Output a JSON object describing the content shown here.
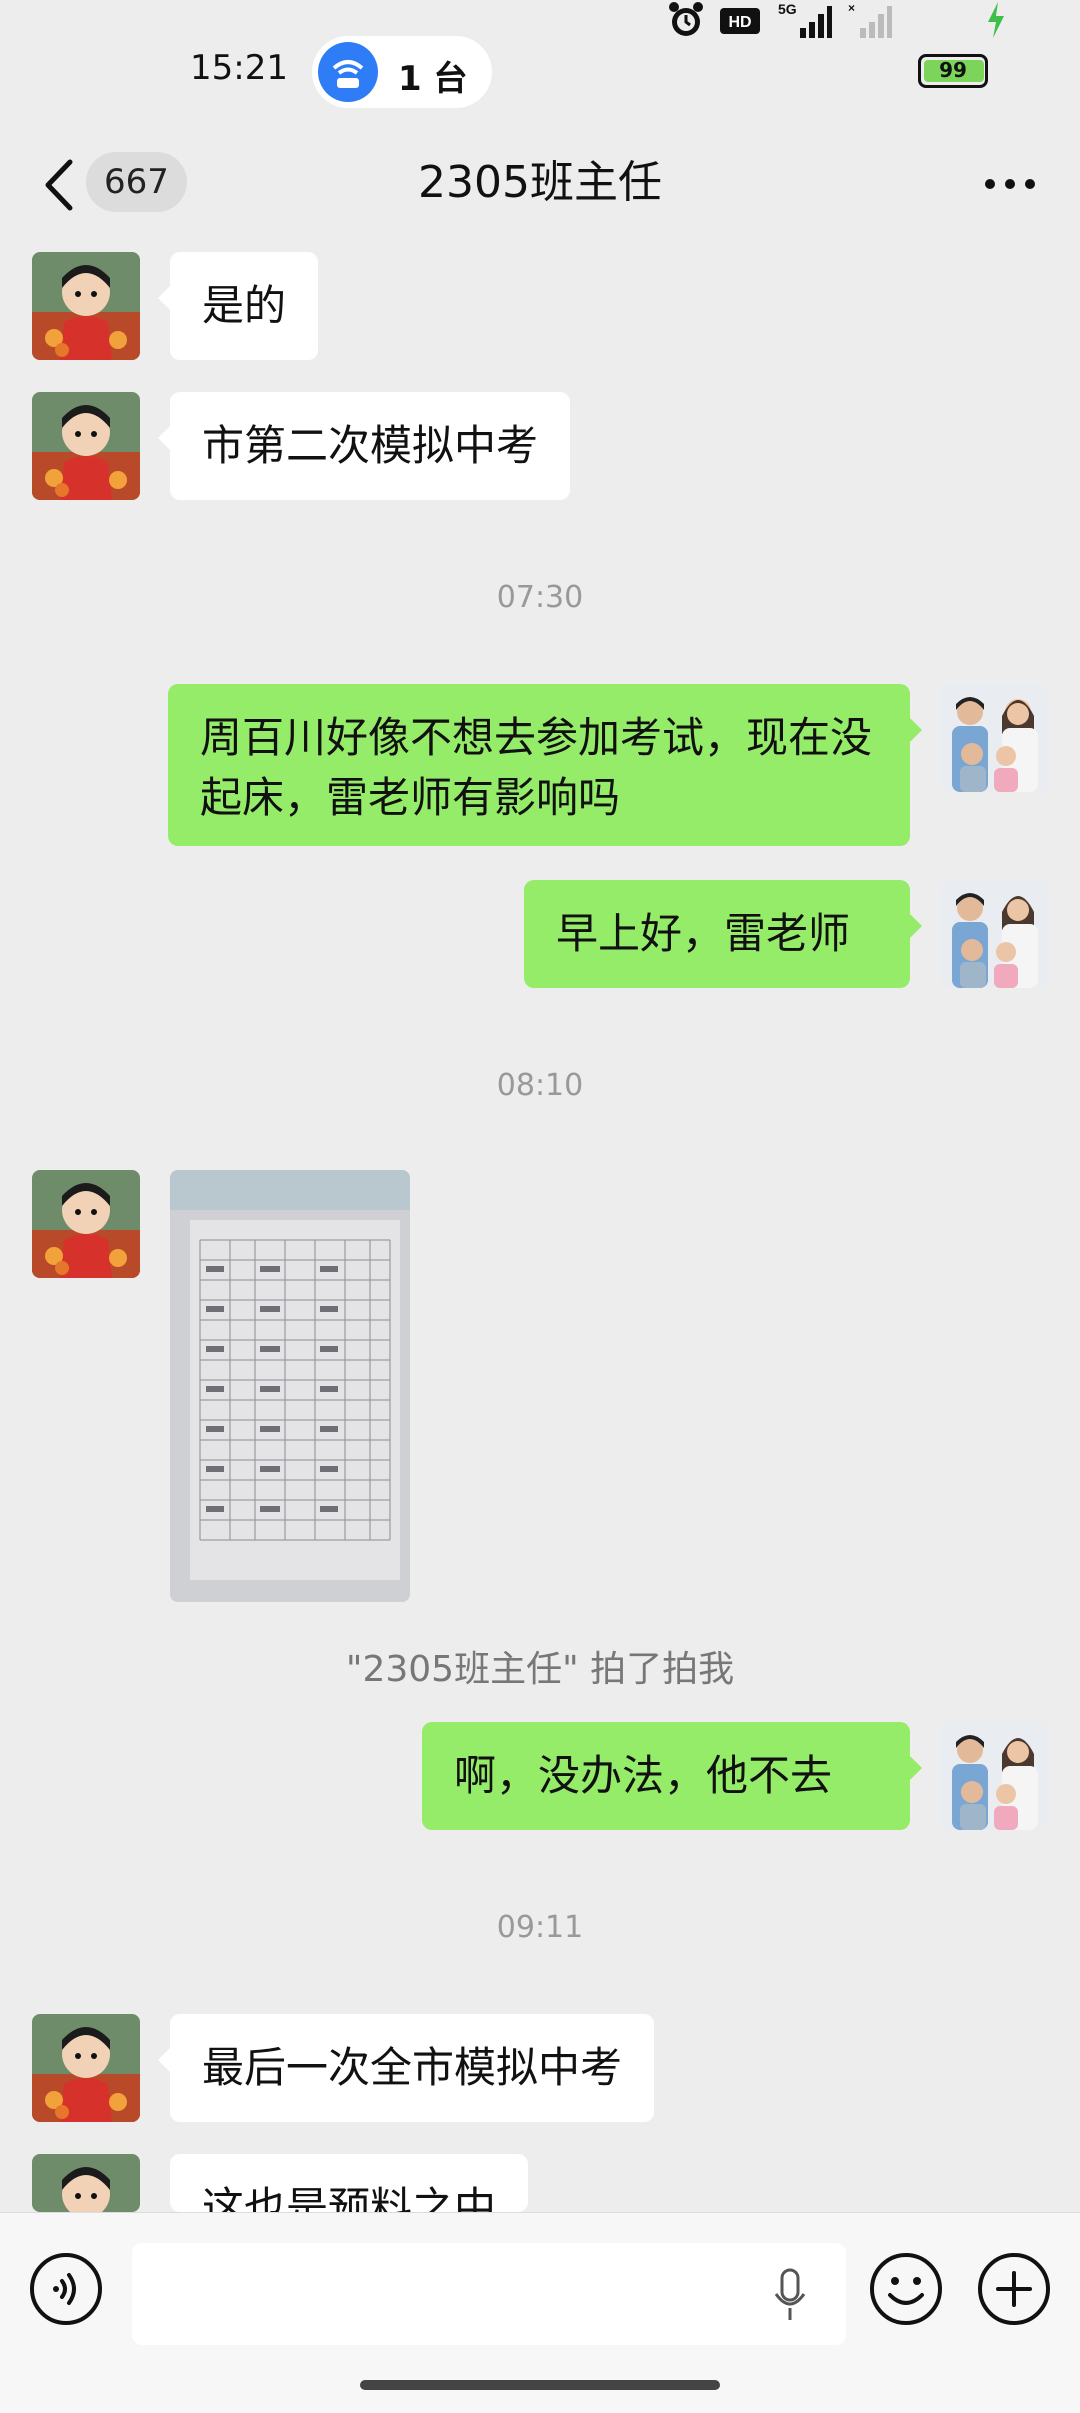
{
  "status_bar": {
    "time": "15:21",
    "hotspot_count": "1 台",
    "battery": "99",
    "network": "5G"
  },
  "header": {
    "unread_count": "667",
    "title": "2305班主任"
  },
  "messages": [
    {
      "side": "left",
      "text": "是的"
    },
    {
      "side": "left",
      "text": "市第二次模拟中考"
    },
    {
      "type": "time",
      "text": "07:30"
    },
    {
      "side": "right",
      "text": "周百川好像不想去参加考试，现在没起床，雷老师有影响吗"
    },
    {
      "side": "right",
      "text": "早上好，雷老师"
    },
    {
      "type": "time",
      "text": "08:10"
    },
    {
      "side": "left",
      "type": "image"
    },
    {
      "type": "system",
      "text": "\"2305班主任\" 拍了拍我"
    },
    {
      "side": "right",
      "text": "啊，没办法，他不去"
    },
    {
      "type": "time",
      "text": "09:11"
    },
    {
      "side": "left",
      "text": "最后一次全市模拟中考"
    },
    {
      "side": "left",
      "text": "这也是预料之中"
    }
  ],
  "colors": {
    "background": "#ededed",
    "sent_bubble": "#95ec69",
    "received_bubble": "#ffffff",
    "timestamp": "#999999"
  }
}
